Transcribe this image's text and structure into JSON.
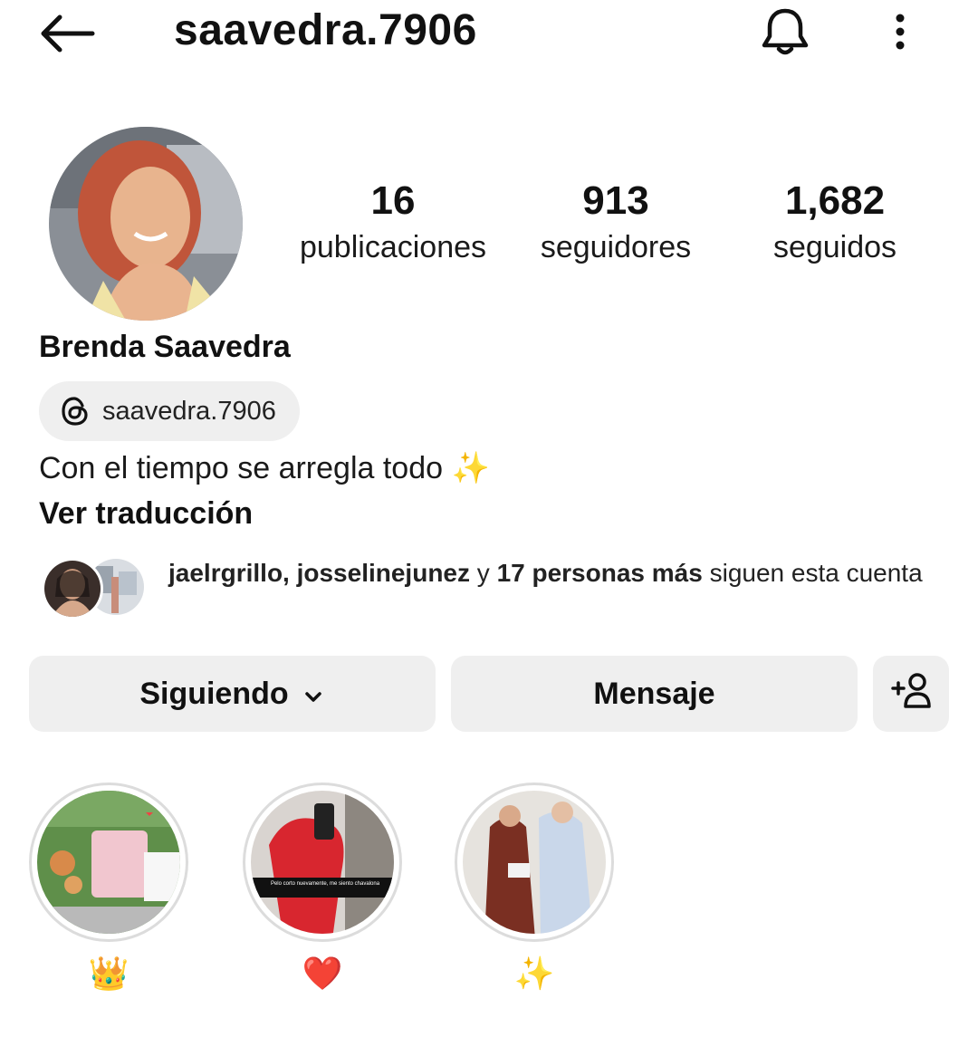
{
  "header": {
    "username": "saavedra.7906",
    "back_icon": "arrow-left-icon",
    "notifications_icon": "bell-icon",
    "more_icon": "more-vertical-icon"
  },
  "profile": {
    "stats": {
      "posts_count": "16",
      "posts_label": "publicaciones",
      "followers_count": "913",
      "followers_label": "seguidores",
      "following_count": "1,682",
      "following_label": "seguidos"
    },
    "full_name": "Brenda Saavedra",
    "threads_handle": "saavedra.7906",
    "bio": "Con el tiempo se arregla todo ✨",
    "translate_label": "Ver traducción"
  },
  "followed_by": {
    "names": "jaelrgrillo, josselinejunez",
    "connector": " y ",
    "others": "17 personas más",
    "suffix": " siguen esta cuenta"
  },
  "actions": {
    "following_label": "Siguiendo",
    "message_label": "Mensaje",
    "add_user_icon": "add-user-icon"
  },
  "highlights": [
    {
      "label": "👑",
      "story_text": ""
    },
    {
      "label": "❤️",
      "story_text": "Pelo corto nuevamente, me siento chavalona"
    },
    {
      "label": "✨",
      "story_text": ""
    }
  ],
  "colors": {
    "button_bg": "#efefef",
    "text": "#111111",
    "highlight_ring": "#dcdcdc"
  }
}
